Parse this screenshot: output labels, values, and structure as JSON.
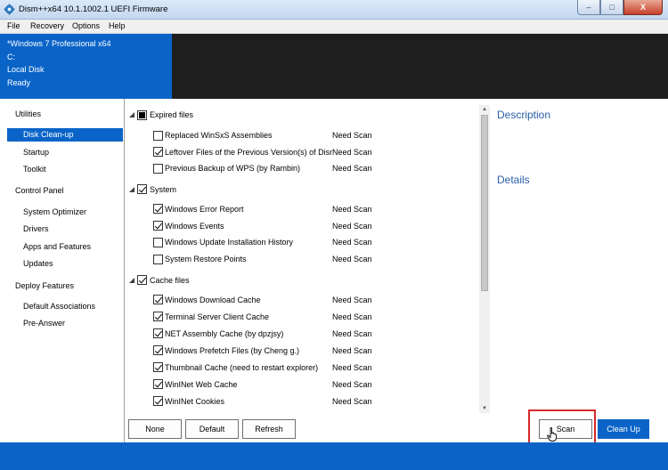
{
  "window": {
    "title": "Dism++x64 10.1.1002.1 UEFI Firmware",
    "minimize": "–",
    "maximize": "□",
    "close": "X"
  },
  "menu": [
    "File",
    "Recovery",
    "Options",
    "Help"
  ],
  "info": {
    "os": "*Windows 7 Professional x64",
    "drive": "C:",
    "disk": "Local Disk",
    "state": "Ready"
  },
  "sidebar": {
    "utilities": "Utilities",
    "disk_cleanup": "Disk Clean-up",
    "startup": "Startup",
    "toolkit": "Toolkit",
    "control_panel": "Control Panel",
    "system_optimizer": "System Optimizer",
    "drivers": "Drivers",
    "apps_features": "Apps and Features",
    "updates": "Updates",
    "deploy_features": "Deploy Features",
    "default_associations": "Default Associations",
    "pre_answer": "Pre-Answer"
  },
  "groups": [
    {
      "label": "Expired files",
      "state": "indeterminate",
      "items": [
        {
          "label": "Replaced WinSxS Assemblies",
          "status": "Need Scan",
          "checked": false
        },
        {
          "label": "Leftover Files of the Previous Version(s) of Dism",
          "status": "Need Scan",
          "checked": true
        },
        {
          "label": "Previous Backup of WPS (by Rambin)",
          "status": "Need Scan",
          "checked": false
        }
      ]
    },
    {
      "label": "System",
      "state": "checked",
      "items": [
        {
          "label": "Windows Error Report",
          "status": "Need Scan",
          "checked": true
        },
        {
          "label": "Windows Events",
          "status": "Need Scan",
          "checked": true
        },
        {
          "label": "Windows Update Installation History",
          "status": "Need Scan",
          "checked": false
        },
        {
          "label": "System Restore Points",
          "status": "Need Scan",
          "checked": false
        }
      ]
    },
    {
      "label": "Cache files",
      "state": "checked",
      "items": [
        {
          "label": "Windows Download Cache",
          "status": "Need Scan",
          "checked": true
        },
        {
          "label": "Terminal Server Client Cache",
          "status": "Need Scan",
          "checked": true
        },
        {
          "label": "NET Assembly Cache (by dpzjsy)",
          "status": "Need Scan",
          "checked": true
        },
        {
          "label": "Windows Prefetch Files (by Cheng g.)",
          "status": "Need Scan",
          "checked": true
        },
        {
          "label": "Thumbnail Cache (need to restart explorer)",
          "status": "Need Scan",
          "checked": true
        },
        {
          "label": "WinINet Web Cache",
          "status": "Need Scan",
          "checked": true
        },
        {
          "label": "WinINet Cookies",
          "status": "Need Scan",
          "checked": true
        }
      ]
    }
  ],
  "buttons": {
    "none": "None",
    "default": "Default",
    "refresh": "Refresh",
    "scan": "Scan",
    "clean_up": "Clean Up"
  },
  "right_panel": {
    "description": "Description",
    "details": "Details"
  },
  "colors": {
    "accent": "#0a64c8",
    "heading": "#2a5fa8",
    "highlight": "#d42a2a"
  }
}
